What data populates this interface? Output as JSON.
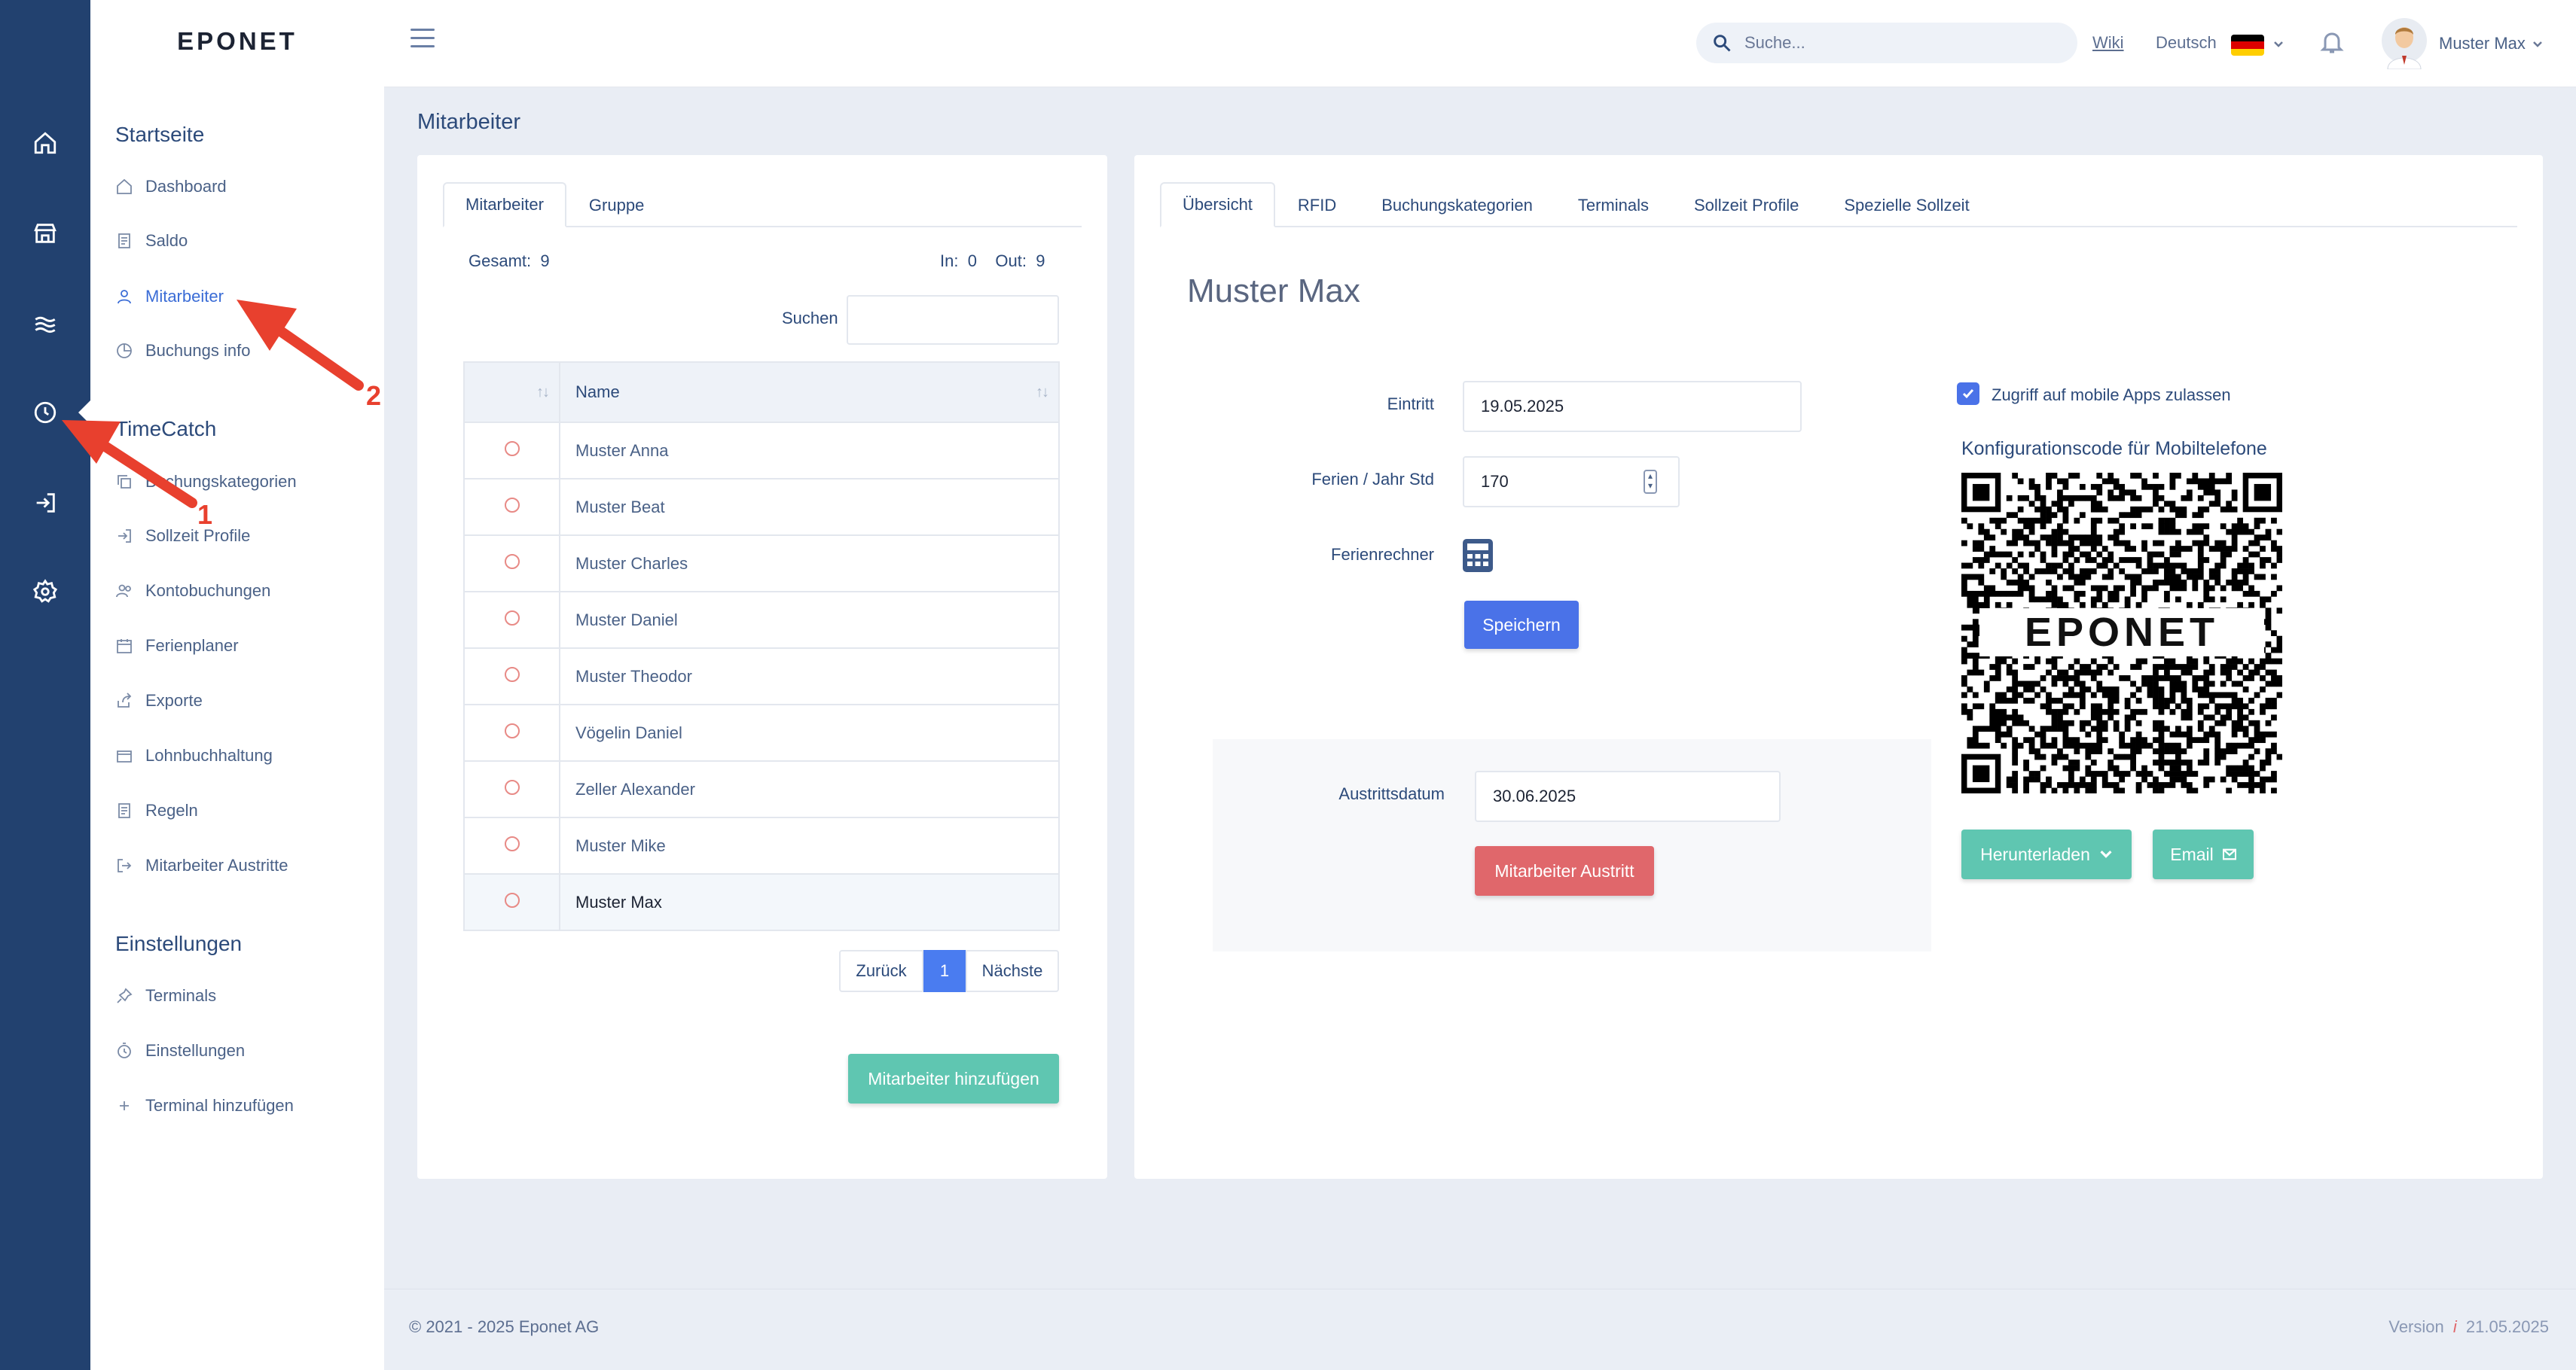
{
  "app": {
    "logo": "EPONET"
  },
  "sidebar": {
    "sections": [
      {
        "title": "Startseite",
        "items": [
          {
            "label": "Dashboard",
            "icon": "home-icon"
          },
          {
            "label": "Saldo",
            "icon": "document-icon"
          },
          {
            "label": "Mitarbeiter",
            "icon": "user-icon",
            "active": true
          },
          {
            "label": "Buchungs info",
            "icon": "pie-chart-icon"
          }
        ]
      },
      {
        "title": "TimeCatch",
        "items": [
          {
            "label": "Buchungskategorien",
            "icon": "copy-icon"
          },
          {
            "label": "Sollzeit Profile",
            "icon": "login-icon"
          },
          {
            "label": "Kontobuchungen",
            "icon": "users-icon"
          },
          {
            "label": "Ferienplaner",
            "icon": "calendar-icon"
          },
          {
            "label": "Exporte",
            "icon": "share-icon"
          },
          {
            "label": "Lohnbuchhaltung",
            "icon": "wallet-icon"
          },
          {
            "label": "Regeln",
            "icon": "document-icon"
          },
          {
            "label": "Mitarbeiter Austritte",
            "icon": "logout-icon"
          }
        ]
      },
      {
        "title": "Einstellungen",
        "items": [
          {
            "label": "Terminals",
            "icon": "pin-icon"
          },
          {
            "label": "Einstellungen",
            "icon": "timer-icon"
          },
          {
            "label": "Terminal hinzufügen",
            "icon": "plus-icon"
          }
        ]
      }
    ]
  },
  "topbar": {
    "search_placeholder": "Suche...",
    "wiki": "Wiki",
    "language": "Deutsch",
    "user_name": "Muster Max"
  },
  "page": {
    "title": "Mitarbeiter"
  },
  "left_panel": {
    "tabs": [
      "Mitarbeiter",
      "Gruppe"
    ],
    "total_label": "Gesamt:",
    "total": "9",
    "in_label": "In:",
    "in": "0",
    "out_label": "Out:",
    "out": "9",
    "search_label": "Suchen",
    "name_header": "Name",
    "employees": [
      "Muster Anna",
      "Muster Beat",
      "Muster Charles",
      "Muster Daniel",
      "Muster Theodor",
      "Vögelin Daniel",
      "Zeller Alexander",
      "Muster Mike",
      "Muster Max"
    ],
    "selected_employee": "Muster Max",
    "pager": {
      "prev": "Zurück",
      "current": "1",
      "next": "Nächste"
    },
    "add_button": "Mitarbeiter hinzufügen"
  },
  "right_panel": {
    "tabs": [
      "Übersicht",
      "RFID",
      "Buchungskategorien",
      "Terminals",
      "Sollzeit Profile",
      "Spezielle Sollzeit"
    ],
    "person_name": "Muster Max",
    "entry_label": "Eintritt",
    "entry_value": "19.05.2025",
    "holiday_label": "Ferien / Jahr Std",
    "holiday_value": "170",
    "calculator_label": "Ferienrechner",
    "save_button": "Speichern",
    "exit_label": "Austrittsdatum",
    "exit_value": "30.06.2025",
    "exit_button": "Mitarbeiter Austritt",
    "mobile_access_label": "Zugriff auf mobile Apps zulassen",
    "mobile_access_checked": true,
    "qr_title": "Konfigurationscode für Mobiltelefone",
    "qr_logo": "EPONET",
    "download_button": "Herunterladen",
    "email_button": "Email"
  },
  "footer": {
    "copyright": "© 2021 - 2025 Eponet AG",
    "version_label": "Version",
    "version_icon": "i",
    "version_date": "21.05.2025"
  },
  "annotations": {
    "arrow_1": "1",
    "arrow_2": "2"
  },
  "colors": {
    "rail": "#22416f",
    "accent": "#4a72e8",
    "teal": "#5fc6b1",
    "danger": "#e0676b",
    "arrow": "#e8402e"
  }
}
